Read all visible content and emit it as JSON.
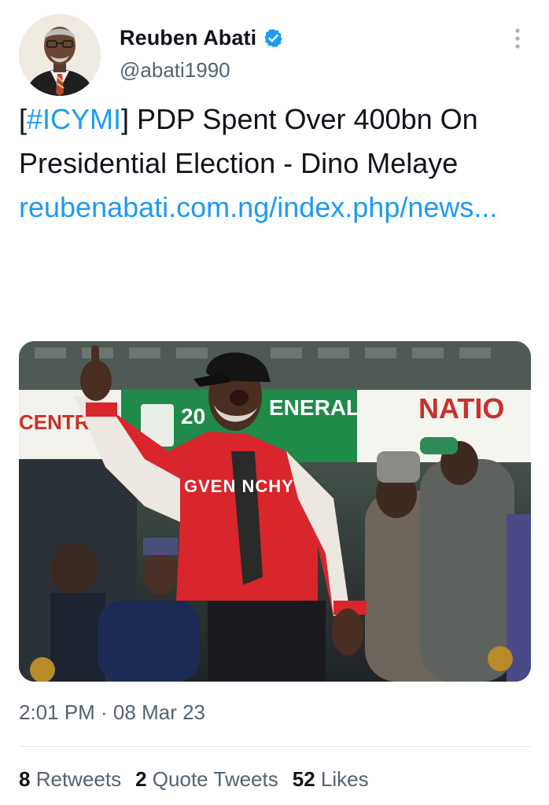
{
  "author": {
    "display_name": "Reuben Abati",
    "handle": "@abati1990",
    "verified": true
  },
  "tweet": {
    "hashtag_prefix": "[",
    "hashtag": "#ICYMI",
    "text_after_hashtag": "] PDP Spent Over 400bn On Presidential Election - Dino Melaye",
    "link": "reubenabati.com.ng/index.php/news...",
    "image_texts": {
      "banner_left": "CENTR",
      "banner_year": "20",
      "banner_mid": "ENERAL",
      "banner_right": "NATIO",
      "jacket": "GVEN NCHY"
    }
  },
  "meta": {
    "timestamp": "2:01 PM · 08 Mar 23"
  },
  "stats": {
    "retweets_count": "8",
    "retweets_label": "Retweets",
    "quotes_count": "2",
    "quotes_label": "Quote Tweets",
    "likes_count": "52",
    "likes_label": "Likes"
  },
  "icons": {
    "verified": "verified-badge-icon",
    "more": "more-vertical-icon"
  },
  "colors": {
    "link": "#1d9bf0",
    "secondary_text": "#536471",
    "primary_text": "#0f1419",
    "jacket_red": "#d8262c",
    "banner_green": "#1f8a4a"
  }
}
